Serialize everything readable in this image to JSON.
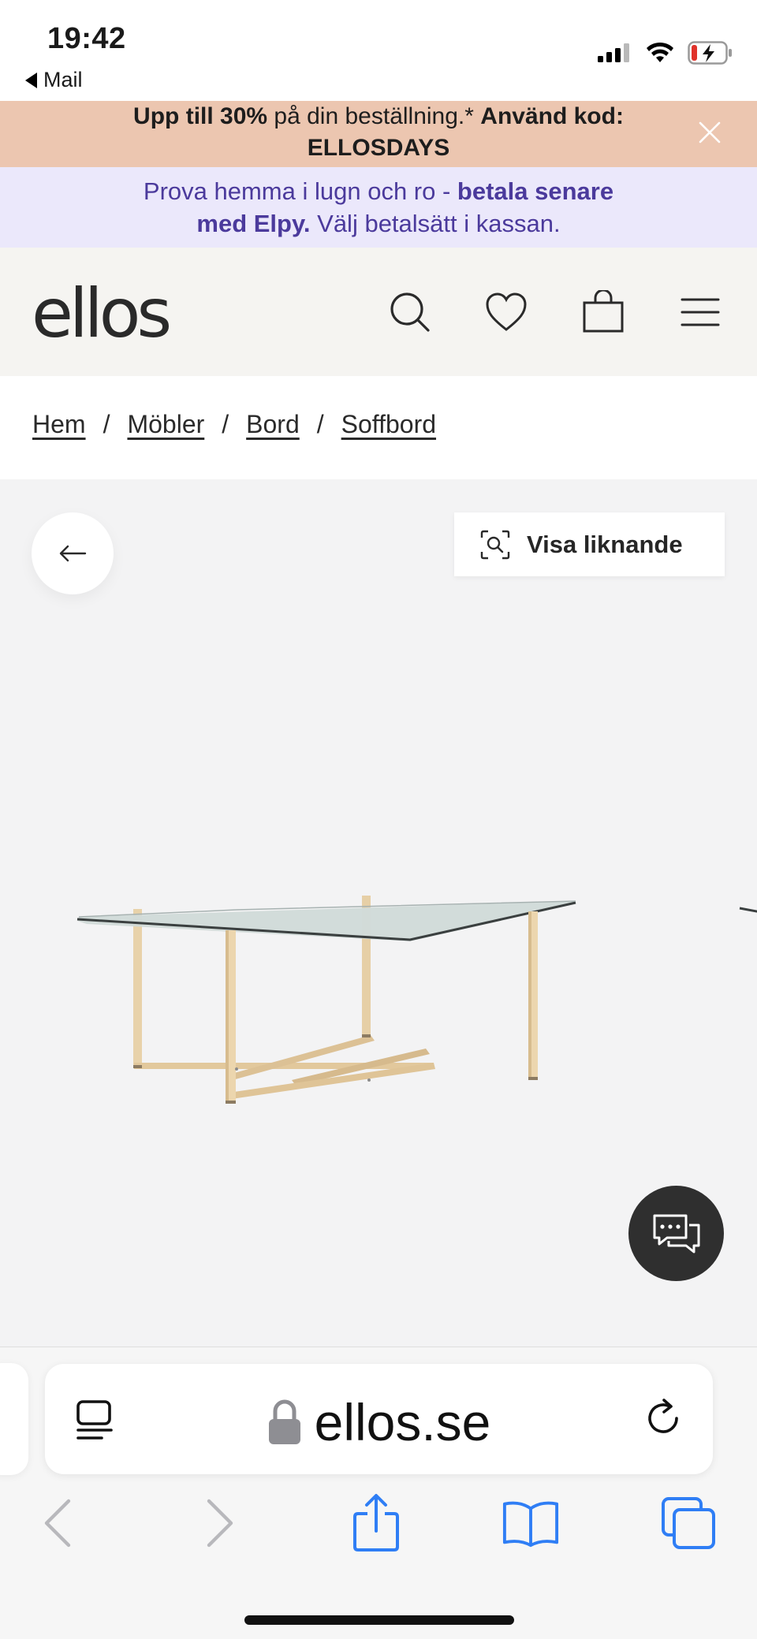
{
  "status_bar": {
    "time": "19:42",
    "back_app": "Mail"
  },
  "promo_banner": {
    "bold_1": "Upp till 30%",
    "text_1": " på din beställning.* ",
    "bold_2": "Använd kod:",
    "code": "ELLOSDAYS"
  },
  "payment_banner": {
    "text_1": "Prova hemma i lugn och ro - ",
    "bold_1": "betala senare",
    "bold_2": "med Elpy.",
    "text_2": " Välj betalsätt i kassan."
  },
  "header": {
    "logo": "ellos"
  },
  "breadcrumb": {
    "items": [
      "Hem",
      "Möbler",
      "Bord",
      "Soffbord"
    ],
    "separator": "/"
  },
  "gallery": {
    "similar_label": "Visa liknande"
  },
  "browser": {
    "url": "ellos.se"
  },
  "colors": {
    "promo_bg": "#ecc6b0",
    "payment_bg": "#ebe8fb",
    "payment_text": "#4b3a9c",
    "header_bg": "#f5f4f1",
    "gallery_bg": "#f3f3f4",
    "safari_blue": "#2f7ef5"
  }
}
